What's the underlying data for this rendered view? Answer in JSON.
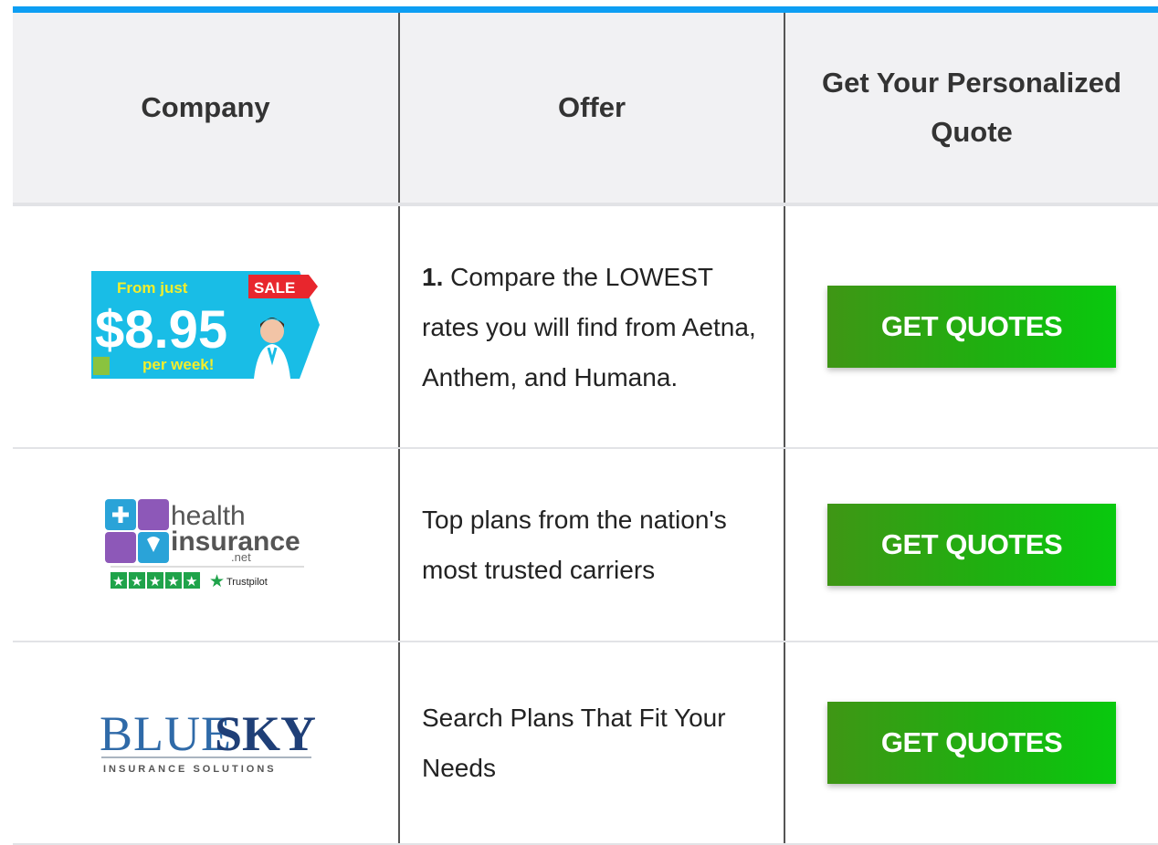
{
  "table": {
    "headers": [
      "Company",
      "Offer",
      "Get Your Personalized Quote"
    ],
    "rows": [
      {
        "logo": {
          "from": "From just",
          "sale": "SALE",
          "price": "$8.95",
          "per": "per week!"
        },
        "offer_num": "1.",
        "offer_text": " Compare the LOWEST rates you will find from Aetna, Anthem, and Humana.",
        "button": "GET QUOTES"
      },
      {
        "logo": {
          "line1": "health",
          "line2": "insurance",
          "line3": ".net",
          "trust": "Trustpilot"
        },
        "offer_text": "Top plans from the nation's most trusted carriers",
        "button": "GET QUOTES"
      },
      {
        "logo": {
          "blue": "BLUE",
          "sky": "SKY",
          "sub": "INSURANCE SOLUTIONS"
        },
        "offer_text": "Search Plans That Fit Your Needs",
        "button": "GET QUOTES"
      }
    ]
  },
  "colors": {
    "accent_bar": "#0d9ef3",
    "button_green": "#1fb010",
    "header_bg": "#f1f1f3"
  }
}
